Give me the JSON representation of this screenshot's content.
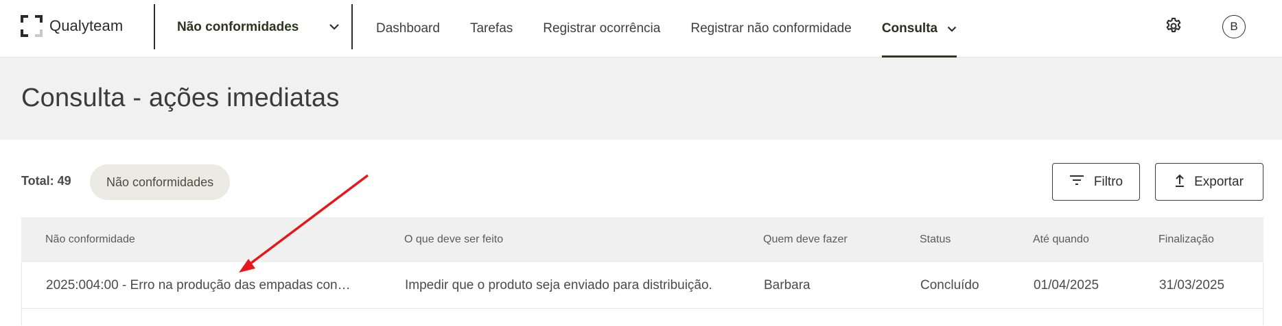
{
  "app": {
    "name": "Qualyteam"
  },
  "module_selector": {
    "label": "Não conformidades",
    "icon": "chevron-down-icon"
  },
  "nav": {
    "items": [
      {
        "label": "Dashboard"
      },
      {
        "label": "Tarefas"
      },
      {
        "label": "Registrar ocorrência"
      },
      {
        "label": "Registrar não conformidade"
      },
      {
        "label": "Consulta",
        "active": true,
        "icon": "chevron-down-icon"
      }
    ]
  },
  "header_actions": {
    "settings_icon": "gear-icon",
    "avatar_initial": "B"
  },
  "page": {
    "title": "Consulta - ações imediatas"
  },
  "toolbar": {
    "total": "Total: 49",
    "chip": "Não conformidades",
    "filter_label": "Filtro",
    "export_label": "Exportar"
  },
  "table": {
    "columns": [
      "Não conformidade",
      "O que deve ser feito",
      "Quem deve fazer",
      "Status",
      "Até quando",
      "Finalização"
    ],
    "rows": [
      {
        "nc": "2025:004:00 - Erro na produção das empadas cong...",
        "what": "Impedir que o produto seja enviado para distribuição.",
        "who": "Barbara",
        "status": "Concluído",
        "due": "01/04/2025",
        "done": "31/03/2025"
      }
    ]
  },
  "colors": {
    "accent": "#2f3521",
    "chip_bg": "#ebebe3",
    "band_bg": "#f1f1f1",
    "annotation_arrow": "#e8161b"
  }
}
